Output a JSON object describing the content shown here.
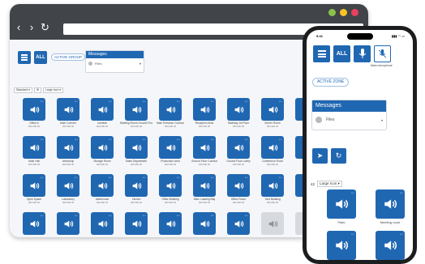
{
  "browser": {
    "window_controls": [
      "minimize",
      "zoom",
      "close"
    ],
    "colors": {
      "chrome": "#414549",
      "accent": "#2067b2",
      "dot_green": "#8bc34a",
      "dot_yellow": "#f7c325",
      "dot_red": "#e8405f"
    },
    "nav": {
      "back_icon": "‹",
      "forward_icon": "›",
      "reload_icon": "↻"
    }
  },
  "desktop": {
    "all_label": "ALL",
    "active_group_label": "ACTIVE GROUP",
    "messages": {
      "title": "Messages",
      "select_value": "Files"
    },
    "filters": [
      "Standard ▾",
      "⊞",
      "Large Icon ▾"
    ],
    "tiles": [
      {
        "label": "Office A",
        "sub": "000 000 00",
        "gray": false
      },
      {
        "label": "Main Corridor",
        "sub": "000 000 00",
        "gray": false
      },
      {
        "label": "Canteen",
        "sub": "000 000 00",
        "gray": false
      },
      {
        "label": "Meeting Room Ground Floor",
        "sub": "000 000 00",
        "gray": false
      },
      {
        "label": "Main Entrance Corridor",
        "sub": "000 000 00",
        "gray": false
      },
      {
        "label": "Reception Area",
        "sub": "000 000 00",
        "gray": false
      },
      {
        "label": "Stairway 1st Floor",
        "sub": "000 000 00",
        "gray": false
      },
      {
        "label": "Server Room",
        "sub": "000 000 00",
        "gray": false
      },
      {
        "label": "",
        "sub": "",
        "gray": false
      },
      {
        "label": "Main Hall",
        "sub": "000 000 00",
        "gray": false
      },
      {
        "label": "Workshop",
        "sub": "000 000 00",
        "gray": false
      },
      {
        "label": "Storage Room",
        "sub": "000 000 00",
        "gray": false
      },
      {
        "label": "Sales Department",
        "sub": "000 000 00",
        "gray": false
      },
      {
        "label": "Production Area",
        "sub": "000 000 00",
        "gray": false
      },
      {
        "label": "Ground Floor Corridor",
        "sub": "000 000 00",
        "gray": false
      },
      {
        "label": "Ground Floor Lobby",
        "sub": "000 000 00",
        "gray": false
      },
      {
        "label": "Conference Room",
        "sub": "000 000 00",
        "gray": false
      },
      {
        "label": "",
        "sub": "",
        "gray": false
      },
      {
        "label": "Open Space",
        "sub": "000 000 00",
        "gray": false
      },
      {
        "label": "Laboratory",
        "sub": "000 000 00",
        "gray": false
      },
      {
        "label": "Warehouse",
        "sub": "000 000 00",
        "gray": false
      },
      {
        "label": "Kitchen",
        "sub": "000 000 00",
        "gray": false
      },
      {
        "label": "Office Building",
        "sub": "000 000 00",
        "gray": false
      },
      {
        "label": "Main Loading Bay",
        "sub": "000 000 00",
        "gray": false
      },
      {
        "label": "Office Room",
        "sub": "000 000 00",
        "gray": false
      },
      {
        "label": "Yard Building",
        "sub": "000 000 00",
        "gray": false
      },
      {
        "label": "",
        "sub": "",
        "gray": false
      },
      {
        "label": "",
        "sub": "",
        "gray": false
      },
      {
        "label": "",
        "sub": "",
        "gray": false
      },
      {
        "label": "",
        "sub": "",
        "gray": false
      },
      {
        "label": "",
        "sub": "",
        "gray": false
      },
      {
        "label": "",
        "sub": "",
        "gray": false
      },
      {
        "label": "",
        "sub": "",
        "gray": false
      },
      {
        "label": "",
        "sub": "",
        "gray": false
      },
      {
        "label": "",
        "sub": "",
        "gray": true
      },
      {
        "label": "",
        "sub": "",
        "gray": true
      }
    ]
  },
  "phone": {
    "time": "9:41",
    "status": "▮▮▮ ◠ ▭",
    "all_label": "ALL",
    "mic_label": "Main microphone",
    "active_zone_label": "ACTIVE ZONE",
    "messages": {
      "title": "Messages",
      "select_value": "Files"
    },
    "filter_count": "42",
    "filter_value": "Large Icon ▾",
    "tiles": [
      {
        "label": "Patio"
      },
      {
        "label": "Meeting room"
      },
      {
        "label": ""
      },
      {
        "label": ""
      }
    ]
  }
}
